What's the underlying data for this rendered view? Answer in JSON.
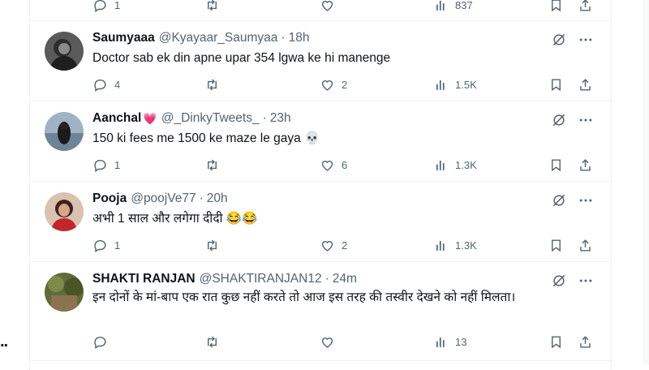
{
  "left_fragment": "..",
  "top_partial": {
    "reply_count": "1",
    "views": "837"
  },
  "tweets": [
    {
      "name": "Saumyaaa",
      "handle": "@Kyayaar_Saumyaa",
      "time": "18h",
      "text": "Doctor sab ek din apne upar 354 lgwa ke hi manenge",
      "reply_count": "4",
      "retweet_count": "",
      "like_count": "2",
      "views": "1.5K"
    },
    {
      "name": "Aanchal",
      "name_emoji": "💗",
      "handle": "@_DinkyTweets_",
      "time": "23h",
      "text": "150 ki fees me 1500 ke maze le gaya 💀",
      "reply_count": "1",
      "retweet_count": "",
      "like_count": "6",
      "views": "1.3K"
    },
    {
      "name": "Pooja",
      "handle": "@poojVe77",
      "time": "20h",
      "text": "अभी 1 साल और लगेगा दीदी 😂😂",
      "reply_count": "1",
      "retweet_count": "",
      "like_count": "2",
      "views": "1.3K"
    },
    {
      "name": "SHAKTI RANJAN",
      "handle": "@SHAKTIRANJAN12",
      "time": "24m",
      "text": "इन दोनों के मां-बाप एक रात कुछ नहीं करते तो आज इस तरह की तस्वीर देखने को नहीं मिलता।",
      "reply_count": "",
      "retweet_count": "",
      "like_count": "",
      "views": "13"
    }
  ],
  "icons": [
    "reply-icon",
    "retweet-icon",
    "like-icon",
    "views-icon",
    "bookmark-icon",
    "share-icon",
    "grok-icon",
    "more-icon"
  ],
  "colors": {
    "text": "#0f1419",
    "secondary": "#536471",
    "divider": "#eff3f4",
    "heart": "#f91880"
  }
}
